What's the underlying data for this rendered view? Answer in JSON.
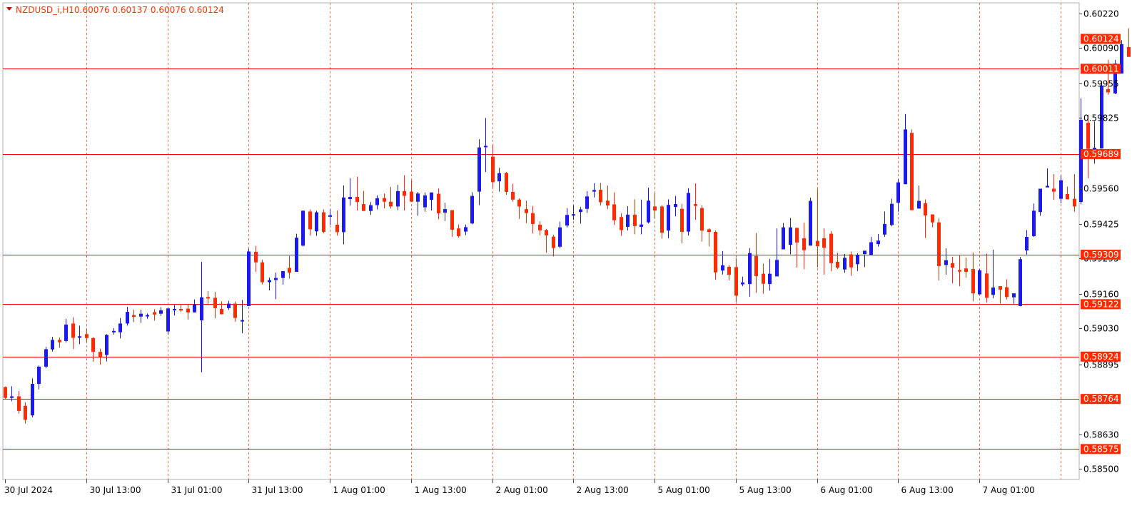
{
  "header": {
    "symbol": "NZDUSD_i,H1",
    "ohlc": "0.60076 0.60137 0.60076 0.60124"
  },
  "colors": {
    "bull": "#1a1af0",
    "bear": "#ff2a00",
    "hline": "#ff0000",
    "vgrid": "#ff6a3a",
    "axis": "#444444",
    "label_bg": "#ff2a00",
    "label_text": "#ffffff",
    "background": "#ffffff"
  },
  "chart_data": {
    "type": "candlestick",
    "timeframe": "H1",
    "ylim": [
      0.5846,
      0.6026
    ],
    "y_ticks": [
      "0.60220",
      "0.60090",
      "0.59955",
      "0.59825",
      "0.59560",
      "0.59425",
      "0.59160",
      "0.59030",
      "0.58895",
      "0.58630",
      "0.58500"
    ],
    "hidden_ticks": [
      "0.59295"
    ],
    "x_labels": [
      "30 Jul 2024",
      "30 Jul 13:00",
      "31 Jul 01:00",
      "31 Jul 13:00",
      "1 Aug 01:00",
      "1 Aug 13:00",
      "2 Aug 01:00",
      "2 Aug 13:00",
      "5 Aug 01:00",
      "5 Aug 13:00",
      "6 Aug 01:00",
      "6 Aug 13:00",
      "7 Aug 01:00"
    ],
    "grid_vertical": "dotted",
    "horizontal_levels": [
      {
        "price": 0.60011,
        "label": "0.60011"
      },
      {
        "price": 0.59689,
        "label": "0.59689"
      },
      {
        "price": 0.59309,
        "label": "0.59309"
      },
      {
        "price": 0.59122,
        "label": "0.59122"
      },
      {
        "price": 0.58924,
        "label": "0.58924"
      },
      {
        "price": 0.58764,
        "label": "0.58764"
      },
      {
        "price": 0.58575,
        "label": "0.58575"
      }
    ],
    "current_price": {
      "price": 0.60124,
      "label": "0.60124"
    },
    "candles": [
      [
        0.58809,
        0.58811,
        0.58765,
        0.58768
      ],
      [
        0.58768,
        0.58812,
        0.58755,
        0.58774
      ],
      [
        0.58774,
        0.58794,
        0.58709,
        0.58719
      ],
      [
        0.58738,
        0.58752,
        0.58671,
        0.58685
      ],
      [
        0.58702,
        0.58842,
        0.58695,
        0.58821
      ],
      [
        0.58821,
        0.5889,
        0.588,
        0.58886
      ],
      [
        0.58886,
        0.58961,
        0.5888,
        0.58952
      ],
      [
        0.58951,
        0.58999,
        0.58943,
        0.58987
      ],
      [
        0.58987,
        0.58996,
        0.58957,
        0.58978
      ],
      [
        0.58983,
        0.59067,
        0.58977,
        0.59045
      ],
      [
        0.59049,
        0.59073,
        0.58953,
        0.58995
      ],
      [
        0.58995,
        0.59041,
        0.58971,
        0.59001
      ],
      [
        0.59009,
        0.59028,
        0.58978,
        0.58994
      ],
      [
        0.58994,
        0.58998,
        0.58905,
        0.58942
      ],
      [
        0.58942,
        0.58954,
        0.58894,
        0.5892
      ],
      [
        0.5893,
        0.59009,
        0.58906,
        0.59006
      ],
      [
        0.59017,
        0.59032,
        0.59007,
        0.59021
      ],
      [
        0.59016,
        0.5907,
        0.58993,
        0.59049
      ],
      [
        0.59049,
        0.59112,
        0.59041,
        0.59093
      ],
      [
        0.59081,
        0.59101,
        0.59054,
        0.59074
      ],
      [
        0.59075,
        0.59101,
        0.59051,
        0.59086
      ],
      [
        0.59077,
        0.59087,
        0.59067,
        0.59081
      ],
      [
        0.59092,
        0.59103,
        0.5906,
        0.59083
      ],
      [
        0.59086,
        0.59111,
        0.59077,
        0.59099
      ],
      [
        0.59019,
        0.59101,
        0.59006,
        0.59106
      ],
      [
        0.59104,
        0.59119,
        0.59079,
        0.59104
      ],
      [
        0.59104,
        0.59119,
        0.59093,
        0.59102
      ],
      [
        0.59105,
        0.5912,
        0.59064,
        0.59091
      ],
      [
        0.59091,
        0.5914,
        0.59091,
        0.59121
      ],
      [
        0.59061,
        0.59282,
        0.58865,
        0.59148
      ],
      [
        0.59149,
        0.59171,
        0.59123,
        0.59145
      ],
      [
        0.59146,
        0.59168,
        0.59069,
        0.59107
      ],
      [
        0.59104,
        0.59133,
        0.59083,
        0.59084
      ],
      [
        0.59107,
        0.59135,
        0.591,
        0.59124
      ],
      [
        0.59124,
        0.59132,
        0.59056,
        0.5907
      ],
      [
        0.5906,
        0.59138,
        0.59012,
        0.59062
      ],
      [
        0.59115,
        0.59331,
        0.59115,
        0.59321
      ],
      [
        0.5932,
        0.59342,
        0.59244,
        0.5928
      ],
      [
        0.5928,
        0.5929,
        0.59197,
        0.59205
      ],
      [
        0.59205,
        0.59223,
        0.59174,
        0.59213
      ],
      [
        0.59213,
        0.59241,
        0.59141,
        0.59221
      ],
      [
        0.59221,
        0.59245,
        0.59196,
        0.59247
      ],
      [
        0.59259,
        0.59304,
        0.59219,
        0.59241
      ],
      [
        0.59244,
        0.59388,
        0.59244,
        0.59373
      ],
      [
        0.59343,
        0.59476,
        0.5934,
        0.59475
      ],
      [
        0.59472,
        0.5948,
        0.59381,
        0.59405
      ],
      [
        0.59397,
        0.59475,
        0.5938,
        0.59469
      ],
      [
        0.59469,
        0.5948,
        0.5939,
        0.59395
      ],
      [
        0.59452,
        0.5948,
        0.59421,
        0.59458
      ],
      [
        0.59422,
        0.59476,
        0.59381,
        0.59394
      ],
      [
        0.59394,
        0.59571,
        0.59348,
        0.59525
      ],
      [
        0.59519,
        0.59597,
        0.59494,
        0.59527
      ],
      [
        0.59527,
        0.59604,
        0.59476,
        0.59508
      ],
      [
        0.595,
        0.5955,
        0.59477,
        0.59474
      ],
      [
        0.59474,
        0.59508,
        0.59459,
        0.59496
      ],
      [
        0.59496,
        0.59533,
        0.5948,
        0.59522
      ],
      [
        0.59523,
        0.5954,
        0.59484,
        0.59509
      ],
      [
        0.59509,
        0.59565,
        0.59483,
        0.59491
      ],
      [
        0.59491,
        0.59573,
        0.59477,
        0.59549
      ],
      [
        0.59549,
        0.59609,
        0.59476,
        0.59531
      ],
      [
        0.59547,
        0.59589,
        0.5951,
        0.59509
      ],
      [
        0.59509,
        0.59546,
        0.59456,
        0.5954
      ],
      [
        0.59488,
        0.59544,
        0.59471,
        0.59533
      ],
      [
        0.59516,
        0.59541,
        0.59476,
        0.59544
      ],
      [
        0.59539,
        0.59559,
        0.59443,
        0.59465
      ],
      [
        0.59468,
        0.59505,
        0.59436,
        0.59481
      ],
      [
        0.59477,
        0.59478,
        0.59377,
        0.59403
      ],
      [
        0.59408,
        0.59423,
        0.59373,
        0.59379
      ],
      [
        0.59396,
        0.59423,
        0.59383,
        0.59413
      ],
      [
        0.59427,
        0.59545,
        0.59424,
        0.59531
      ],
      [
        0.59547,
        0.59745,
        0.59496,
        0.59714
      ],
      [
        0.5972,
        0.59825,
        0.59621,
        0.5972
      ],
      [
        0.59679,
        0.59725,
        0.59563,
        0.59583
      ],
      [
        0.59586,
        0.59637,
        0.59547,
        0.59617
      ],
      [
        0.59618,
        0.59621,
        0.59535,
        0.59546
      ],
      [
        0.59546,
        0.59577,
        0.59509,
        0.59517
      ],
      [
        0.59517,
        0.59522,
        0.59444,
        0.59491
      ],
      [
        0.59481,
        0.59513,
        0.59428,
        0.59466
      ],
      [
        0.59466,
        0.59493,
        0.59389,
        0.59425
      ],
      [
        0.59422,
        0.59435,
        0.59382,
        0.59401
      ],
      [
        0.59402,
        0.59406,
        0.59316,
        0.59382
      ],
      [
        0.59377,
        0.59384,
        0.59302,
        0.59334
      ],
      [
        0.59339,
        0.59434,
        0.59333,
        0.59412
      ],
      [
        0.59419,
        0.59485,
        0.59412,
        0.59459
      ],
      [
        0.59459,
        0.59495,
        0.5944,
        0.59462
      ],
      [
        0.5947,
        0.59489,
        0.59426,
        0.5948
      ],
      [
        0.59482,
        0.59549,
        0.59466,
        0.59529
      ],
      [
        0.59547,
        0.59579,
        0.59525,
        0.59553
      ],
      [
        0.59554,
        0.5958,
        0.59494,
        0.59507
      ],
      [
        0.59513,
        0.5957,
        0.59481,
        0.59495
      ],
      [
        0.59499,
        0.59544,
        0.59421,
        0.59439
      ],
      [
        0.59451,
        0.59465,
        0.5938,
        0.59402
      ],
      [
        0.59414,
        0.59492,
        0.594,
        0.5946
      ],
      [
        0.5946,
        0.59518,
        0.59386,
        0.59417
      ],
      [
        0.59414,
        0.59517,
        0.59386,
        0.59423
      ],
      [
        0.59431,
        0.59562,
        0.59427,
        0.59513
      ],
      [
        0.59491,
        0.59541,
        0.59446,
        0.59476
      ],
      [
        0.59491,
        0.59496,
        0.59369,
        0.59392
      ],
      [
        0.594,
        0.59518,
        0.59371,
        0.59497
      ],
      [
        0.59489,
        0.59531,
        0.59454,
        0.595
      ],
      [
        0.59482,
        0.59501,
        0.59352,
        0.59395
      ],
      [
        0.59396,
        0.5956,
        0.59381,
        0.59542
      ],
      [
        0.595,
        0.59578,
        0.5944,
        0.59493
      ],
      [
        0.59485,
        0.59496,
        0.59358,
        0.594
      ],
      [
        0.59405,
        0.59409,
        0.5934,
        0.59395
      ],
      [
        0.59395,
        0.594,
        0.59214,
        0.59242
      ],
      [
        0.59249,
        0.59323,
        0.59234,
        0.59269
      ],
      [
        0.59263,
        0.5927,
        0.59212,
        0.59233
      ],
      [
        0.59262,
        0.59296,
        0.5913,
        0.59154
      ],
      [
        0.59197,
        0.59226,
        0.5919,
        0.59204
      ],
      [
        0.59198,
        0.59334,
        0.5915,
        0.59315
      ],
      [
        0.59304,
        0.59391,
        0.59165,
        0.59228
      ],
      [
        0.59237,
        0.59275,
        0.59162,
        0.59199
      ],
      [
        0.59198,
        0.59293,
        0.59173,
        0.59237
      ],
      [
        0.59227,
        0.59408,
        0.59227,
        0.59289
      ],
      [
        0.59329,
        0.59429,
        0.59329,
        0.59412
      ],
      [
        0.59346,
        0.59448,
        0.5931,
        0.59412
      ],
      [
        0.5941,
        0.59412,
        0.5926,
        0.59355
      ],
      [
        0.59371,
        0.5943,
        0.59254,
        0.59326
      ],
      [
        0.59343,
        0.59524,
        0.59347,
        0.59512
      ],
      [
        0.59361,
        0.59556,
        0.59261,
        0.59341
      ],
      [
        0.59371,
        0.59408,
        0.59233,
        0.59335
      ],
      [
        0.59388,
        0.59398,
        0.59246,
        0.59277
      ],
      [
        0.59282,
        0.59316,
        0.59255,
        0.5926
      ],
      [
        0.59253,
        0.59312,
        0.5924,
        0.59297
      ],
      [
        0.5931,
        0.59321,
        0.59229,
        0.59261
      ],
      [
        0.59273,
        0.59315,
        0.59247,
        0.59309
      ],
      [
        0.59311,
        0.5931,
        0.59262,
        0.59324
      ],
      [
        0.59308,
        0.59376,
        0.59312,
        0.59356
      ],
      [
        0.59349,
        0.59387,
        0.59339,
        0.59362
      ],
      [
        0.59385,
        0.59472,
        0.59376,
        0.59425
      ],
      [
        0.59421,
        0.5952,
        0.59416,
        0.59501
      ],
      [
        0.59505,
        0.59594,
        0.59471,
        0.59582
      ],
      [
        0.59575,
        0.5984,
        0.5958,
        0.59782
      ],
      [
        0.59769,
        0.59782,
        0.59482,
        0.59477
      ],
      [
        0.59483,
        0.5957,
        0.59502,
        0.59512
      ],
      [
        0.59503,
        0.59518,
        0.59372,
        0.59457
      ],
      [
        0.59461,
        0.5946,
        0.59413,
        0.59431
      ],
      [
        0.59431,
        0.59446,
        0.59211,
        0.59266
      ],
      [
        0.5927,
        0.59333,
        0.59233,
        0.59288
      ],
      [
        0.59277,
        0.59301,
        0.59201,
        0.5926
      ],
      [
        0.59251,
        0.59307,
        0.5919,
        0.59245
      ],
      [
        0.59257,
        0.59298,
        0.59222,
        0.59244
      ],
      [
        0.59255,
        0.59317,
        0.59133,
        0.59163
      ],
      [
        0.59159,
        0.59255,
        0.59161,
        0.5925
      ],
      [
        0.59238,
        0.59313,
        0.59128,
        0.59146
      ],
      [
        0.59157,
        0.59328,
        0.59144,
        0.59185
      ],
      [
        0.5919,
        0.59188,
        0.59124,
        0.59177
      ],
      [
        0.59186,
        0.59216,
        0.5914,
        0.59149
      ],
      [
        0.59148,
        0.59159,
        0.5912,
        0.59163
      ],
      [
        0.59115,
        0.593,
        0.59114,
        0.59292
      ],
      [
        0.59325,
        0.59402,
        0.59306,
        0.59376
      ],
      [
        0.59379,
        0.59502,
        0.59376,
        0.59475
      ],
      [
        0.5947,
        0.5955,
        0.59456,
        0.59558
      ],
      [
        0.59563,
        0.59635,
        0.59563,
        0.59569
      ],
      [
        0.59558,
        0.59613,
        0.59516,
        0.59547
      ],
      [
        0.5952,
        0.59608,
        0.59503,
        0.5959
      ],
      [
        0.59538,
        0.59566,
        0.59522,
        0.59518
      ],
      [
        0.5952,
        0.59613,
        0.59471,
        0.59491
      ],
      [
        0.59508,
        0.59899,
        0.59499,
        0.59818
      ],
      [
        0.59807,
        0.59838,
        0.59597,
        0.59709
      ],
      [
        0.5971,
        0.59812,
        0.59653,
        0.59713
      ],
      [
        0.5971,
        0.59965,
        0.5971,
        0.59948
      ],
      [
        0.59934,
        0.60045,
        0.59913,
        0.59922
      ],
      [
        0.59918,
        0.60045,
        0.59915,
        0.60031
      ],
      [
        0.59993,
        0.60119,
        0.59993,
        0.60104
      ],
      [
        0.60093,
        0.60164,
        0.6006,
        0.60056
      ],
      [
        0.60076,
        0.60137,
        0.60076,
        0.60124
      ]
    ]
  }
}
